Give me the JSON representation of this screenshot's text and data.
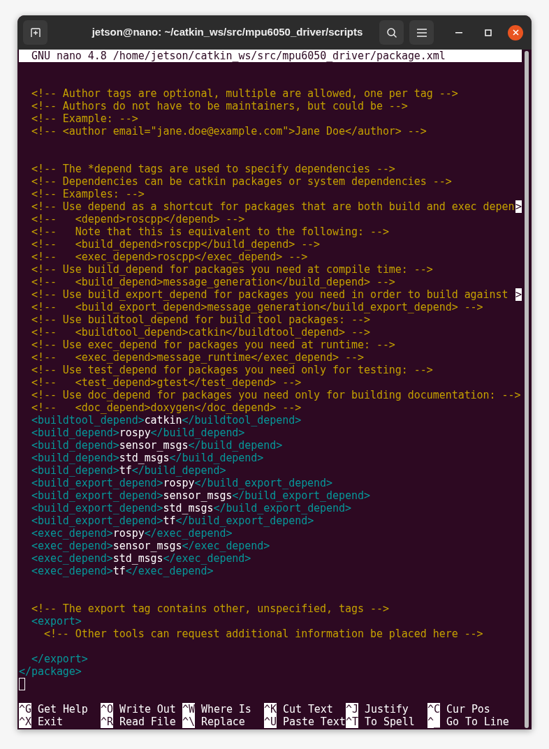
{
  "window": {
    "title": "jetson@nano: ~/catkin_ws/src/mpu6050_driver/scripts"
  },
  "editor": {
    "version": "GNU nano 4.8",
    "filename": "/home/jetson/catkin_ws/src/mpu6050_driver/package.xml",
    "lines": [
      {
        "kind": "blank"
      },
      {
        "kind": "blank"
      },
      {
        "kind": "comment",
        "text": "  <!-- Author tags are optional, multiple are allowed, one per tag -->"
      },
      {
        "kind": "comment",
        "text": "  <!-- Authors do not have to be maintainers, but could be -->"
      },
      {
        "kind": "comment",
        "text": "  <!-- Example: -->"
      },
      {
        "kind": "comment",
        "text": "  <!-- <author email=\"jane.doe@example.com\">Jane Doe</author> -->"
      },
      {
        "kind": "blank"
      },
      {
        "kind": "blank"
      },
      {
        "kind": "comment",
        "text": "  <!-- The *depend tags are used to specify dependencies -->"
      },
      {
        "kind": "comment",
        "text": "  <!-- Dependencies can be catkin packages or system dependencies -->"
      },
      {
        "kind": "comment",
        "text": "  <!-- Examples: -->"
      },
      {
        "kind": "comment",
        "text": "  <!-- Use depend as a shortcut for packages that are both build and exec depen",
        "overflow": ">"
      },
      {
        "kind": "comment",
        "text": "  <!--   <depend>roscpp</depend> -->"
      },
      {
        "kind": "comment",
        "text": "  <!--   Note that this is equivalent to the following: -->"
      },
      {
        "kind": "comment",
        "text": "  <!--   <build_depend>roscpp</build_depend> -->"
      },
      {
        "kind": "comment",
        "text": "  <!--   <exec_depend>roscpp</exec_depend> -->"
      },
      {
        "kind": "comment",
        "text": "  <!-- Use build_depend for packages you need at compile time: -->"
      },
      {
        "kind": "comment",
        "text": "  <!--   <build_depend>message_generation</build_depend> -->"
      },
      {
        "kind": "comment",
        "text": "  <!-- Use build_export_depend for packages you need in order to build against",
        "overflow": ">"
      },
      {
        "kind": "comment",
        "text": "  <!--   <build_export_depend>message_generation</build_export_depend> -->"
      },
      {
        "kind": "comment",
        "text": "  <!-- Use buildtool_depend for build tool packages: -->"
      },
      {
        "kind": "comment",
        "text": "  <!--   <buildtool_depend>catkin</buildtool_depend> -->"
      },
      {
        "kind": "comment",
        "text": "  <!-- Use exec_depend for packages you need at runtime: -->"
      },
      {
        "kind": "comment",
        "text": "  <!--   <exec_depend>message_runtime</exec_depend> -->"
      },
      {
        "kind": "comment",
        "text": "  <!-- Use test_depend for packages you need only for testing: -->"
      },
      {
        "kind": "comment",
        "text": "  <!--   <test_depend>gtest</test_depend> -->"
      },
      {
        "kind": "comment",
        "text": "  <!-- Use doc_depend for packages you need only for building documentation: -->"
      },
      {
        "kind": "comment",
        "text": "  <!--   <doc_depend>doxygen</doc_depend> -->"
      },
      {
        "kind": "element",
        "open": "  <buildtool_depend>",
        "value": "catkin",
        "close": "</buildtool_depend>"
      },
      {
        "kind": "element",
        "open": "  <build_depend>",
        "value": "rospy",
        "close": "</build_depend>"
      },
      {
        "kind": "element",
        "open": "  <build_depend>",
        "value": "sensor_msgs",
        "close": "</build_depend>"
      },
      {
        "kind": "element",
        "open": "  <build_depend>",
        "value": "std_msgs",
        "close": "</build_depend>"
      },
      {
        "kind": "element",
        "open": "  <build_depend>",
        "value": "tf",
        "close": "</build_depend>"
      },
      {
        "kind": "element",
        "open": "  <build_export_depend>",
        "value": "rospy",
        "close": "</build_export_depend>"
      },
      {
        "kind": "element",
        "open": "  <build_export_depend>",
        "value": "sensor_msgs",
        "close": "</build_export_depend>"
      },
      {
        "kind": "element",
        "open": "  <build_export_depend>",
        "value": "std_msgs",
        "close": "</build_export_depend>"
      },
      {
        "kind": "element",
        "open": "  <build_export_depend>",
        "value": "tf",
        "close": "</build_export_depend>"
      },
      {
        "kind": "element",
        "open": "  <exec_depend>",
        "value": "rospy",
        "close": "</exec_depend>"
      },
      {
        "kind": "element",
        "open": "  <exec_depend>",
        "value": "sensor_msgs",
        "close": "</exec_depend>"
      },
      {
        "kind": "element",
        "open": "  <exec_depend>",
        "value": "std_msgs",
        "close": "</exec_depend>"
      },
      {
        "kind": "element",
        "open": "  <exec_depend>",
        "value": "tf",
        "close": "</exec_depend>"
      },
      {
        "kind": "blank"
      },
      {
        "kind": "blank"
      },
      {
        "kind": "comment",
        "text": "  <!-- The export tag contains other, unspecified, tags -->"
      },
      {
        "kind": "tag",
        "text": "  <export>"
      },
      {
        "kind": "comment",
        "text": "    <!-- Other tools can request additional information be placed here -->"
      },
      {
        "kind": "blank"
      },
      {
        "kind": "tag",
        "text": "  </export>"
      },
      {
        "kind": "tag",
        "text": "</package>"
      },
      {
        "kind": "cursor"
      }
    ],
    "shortcuts": [
      [
        {
          "key": "^G",
          "label": "Get Help"
        },
        {
          "key": "^O",
          "label": "Write Out"
        },
        {
          "key": "^W",
          "label": "Where Is"
        },
        {
          "key": "^K",
          "label": "Cut Text"
        },
        {
          "key": "^J",
          "label": "Justify"
        },
        {
          "key": "^C",
          "label": "Cur Pos"
        }
      ],
      [
        {
          "key": "^X",
          "label": "Exit"
        },
        {
          "key": "^R",
          "label": "Read File"
        },
        {
          "key": "^\\",
          "label": "Replace"
        },
        {
          "key": "^U",
          "label": "Paste Text"
        },
        {
          "key": "^T",
          "label": "To Spell"
        },
        {
          "key": "^_",
          "label": "Go To Line"
        }
      ]
    ]
  }
}
